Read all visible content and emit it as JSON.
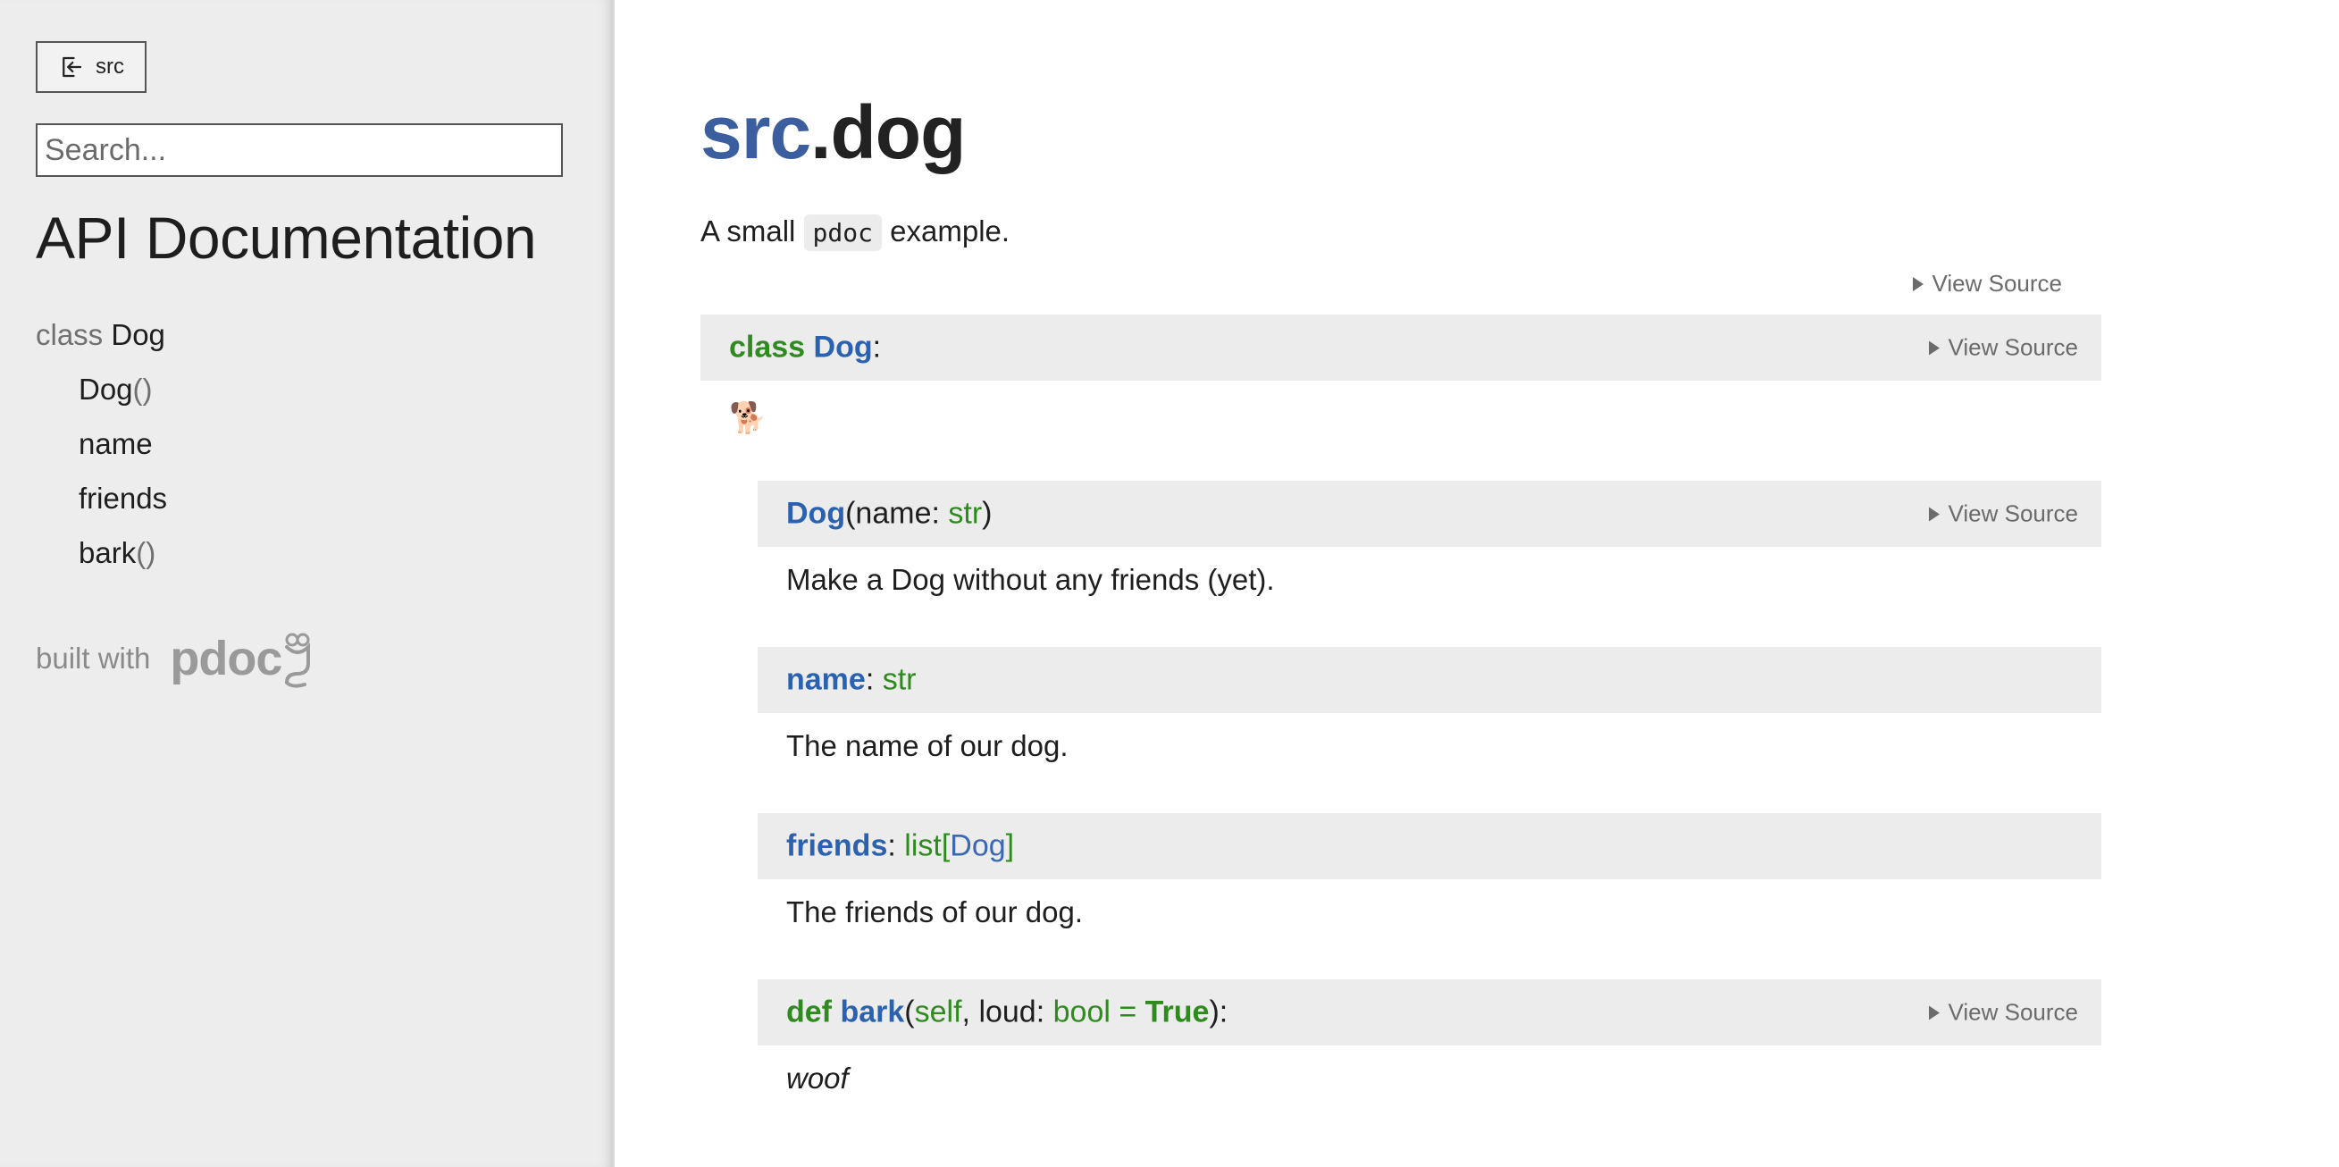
{
  "sidebar": {
    "up_button_label": "src",
    "search_placeholder": "Search...",
    "title": "API Documentation",
    "nav": {
      "class_keyword": "class",
      "class_name": "Dog",
      "members": [
        {
          "name": "Dog",
          "suffix": "()"
        },
        {
          "name": "name",
          "suffix": ""
        },
        {
          "name": "friends",
          "suffix": ""
        },
        {
          "name": "bark",
          "suffix": "()"
        }
      ]
    },
    "built_with_label": "built with",
    "logo_text": "pdoc"
  },
  "main": {
    "title_package": "src",
    "title_module": ".dog",
    "docstring": {
      "before": "A small",
      "code": "pdoc",
      "after": "example."
    },
    "view_source_label": "View Source",
    "class_block": {
      "keyword": "class",
      "name": "Dog",
      "colon": ":",
      "doc_emoji": "🐕"
    },
    "members": [
      {
        "name": "Dog",
        "open": "(",
        "param": "name",
        "sep": ": ",
        "type": "str",
        "close": ")",
        "doc": "Make a Dog without any friends (yet)."
      },
      {
        "name": "name",
        "sep": ": ",
        "type": "str",
        "doc": "The name of our dog."
      },
      {
        "name": "friends",
        "sep": ": ",
        "type_outer": "list[",
        "type_inner": "Dog",
        "type_close": "]",
        "doc": "The friends of our dog."
      },
      {
        "keyword": "def",
        "name": "bark",
        "open": "(",
        "self": "self",
        "comma": ", ",
        "param": "loud",
        "sep": ": ",
        "type": "bool",
        "eq": " = ",
        "default": "True",
        "close": "):",
        "doc": "woof"
      }
    ]
  }
}
